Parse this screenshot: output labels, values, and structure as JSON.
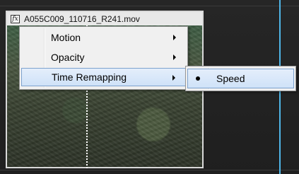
{
  "clip": {
    "fx_badge": "fx",
    "name": "A055C009_110716_R241.mov"
  },
  "context_menu": {
    "items": [
      {
        "label": "Motion",
        "has_submenu": true
      },
      {
        "label": "Opacity",
        "has_submenu": true
      },
      {
        "label": "Time Remapping",
        "has_submenu": true,
        "highlighted": true
      }
    ]
  },
  "submenu": {
    "items": [
      {
        "label": "Speed",
        "checked": true
      }
    ]
  },
  "colors": {
    "playhead": "#4fb6e8",
    "highlight": "#cfe2f8"
  }
}
